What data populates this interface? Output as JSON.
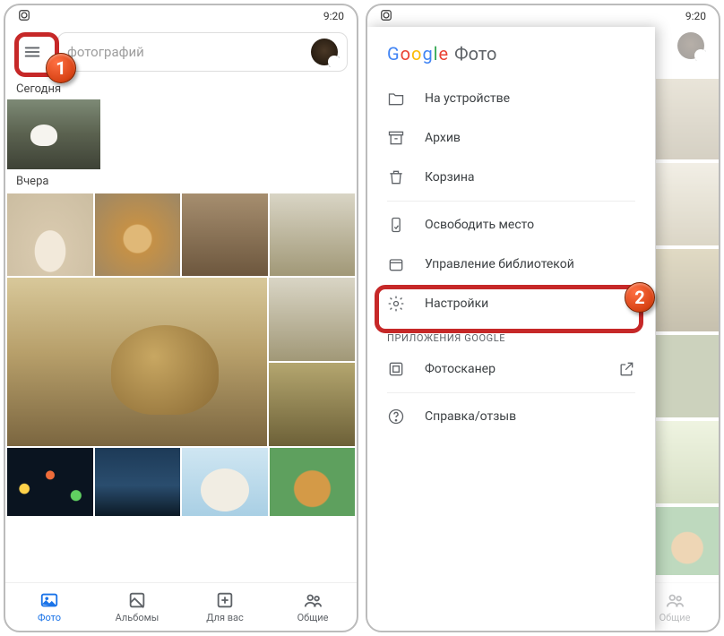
{
  "status": {
    "time": "9:20"
  },
  "left": {
    "search_placeholder": "фотографий",
    "sections": {
      "today": "Сегодня",
      "yesterday": "Вчера"
    },
    "nav": {
      "photos": "Фото",
      "albums": "Альбомы",
      "foryou": "Для вас",
      "sharing": "Общие"
    }
  },
  "annotations": {
    "step1": "1",
    "step2": "2"
  },
  "drawer": {
    "brand_google": "Google",
    "brand_product": "Фото",
    "items": {
      "on_device": "На устройстве",
      "archive": "Архив",
      "trash": "Корзина",
      "free_up": "Освободить место",
      "library_mgmt": "Управление библиотекой",
      "settings": "Настройки"
    },
    "section_apps": "ПРИЛОЖЕНИЯ GOOGLE",
    "photoscan": "Фотосканер",
    "help": "Справка/отзыв"
  },
  "right_nav": {
    "sharing": "Общие"
  }
}
